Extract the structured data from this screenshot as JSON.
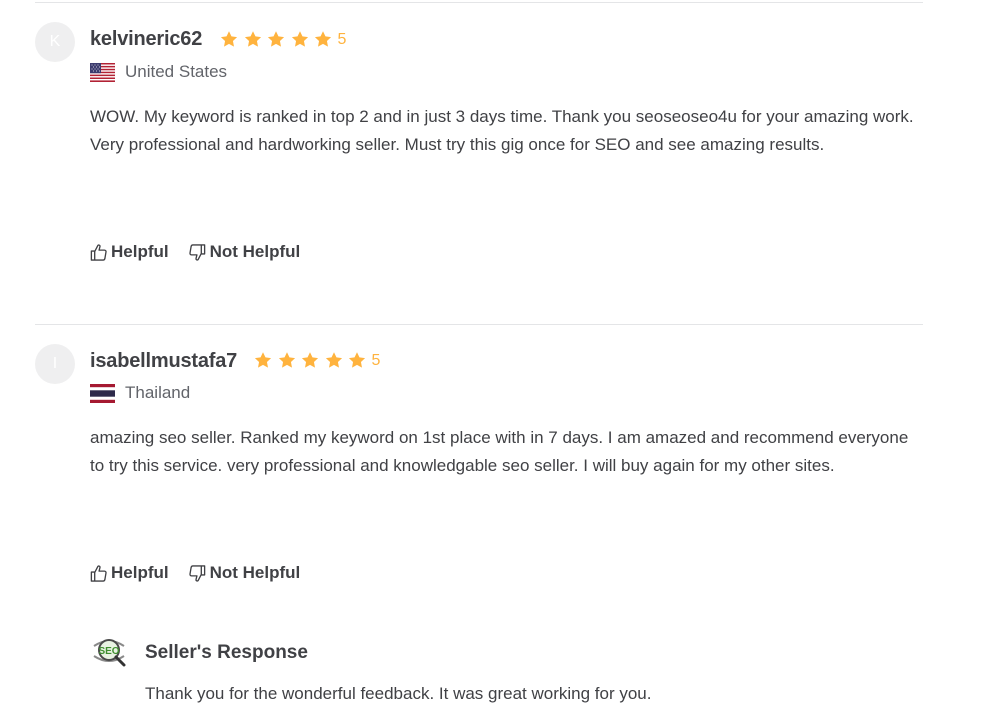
{
  "colors": {
    "star": "#ffb33e",
    "text": "#404145",
    "muted": "#62646a",
    "divider": "#e4e5e7"
  },
  "reviews": [
    {
      "avatar_initial": "K",
      "username": "kelvineric62",
      "rating": "5",
      "stars": 5,
      "country": "United States",
      "flag_icon": "us-flag-icon",
      "text": "WOW. My keyword is ranked in top 2 and in just 3 days time. Thank you seoseoseo4u for your amazing work. Very professional and hardworking seller. Must try this gig once for SEO and see amazing results.",
      "helpful_label": "Helpful",
      "not_helpful_label": "Not Helpful"
    },
    {
      "avatar_initial": "I",
      "username": "isabellmustafa7",
      "rating": "5",
      "stars": 5,
      "country": "Thailand",
      "flag_icon": "thailand-flag-icon",
      "text": "amazing seo seller. Ranked my keyword on 1st place with in 7 days. I am amazed and recommend everyone to try this service. very professional and knowledgable seo seller. I will buy again for my other sites.",
      "helpful_label": "Helpful",
      "not_helpful_label": "Not Helpful"
    }
  ],
  "seller_response": {
    "logo_text": "SEO",
    "title": "Seller's Response",
    "text": "Thank you for the wonderful feedback. It was great working for you."
  }
}
